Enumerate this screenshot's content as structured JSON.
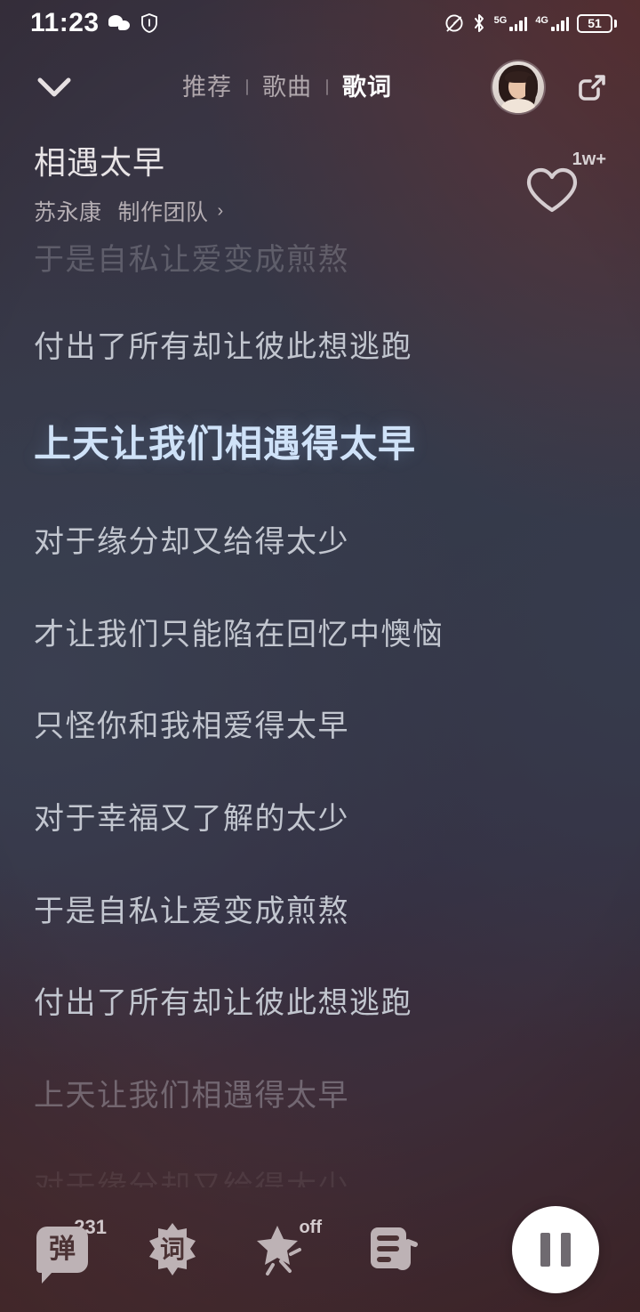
{
  "status_bar": {
    "time": "11:23",
    "icons": [
      "wechat-icon",
      "shield-icon",
      "dnd-icon",
      "bluetooth-icon"
    ],
    "network_5g": "5G",
    "network_5g_sub": "4G",
    "network_4g": "4G",
    "battery_percent": "51"
  },
  "nav": {
    "collapse_icon": "chevron-down-icon",
    "tabs": [
      {
        "label": "推荐",
        "active": false
      },
      {
        "label": "歌曲",
        "active": false
      },
      {
        "label": "歌词",
        "active": true
      }
    ],
    "avatar_label": "avatar",
    "share_icon": "share-icon"
  },
  "song": {
    "title": "相遇太早",
    "artist": "苏永康",
    "credits": "制作团队",
    "credits_chevron": "›",
    "like_count": "1w+",
    "like_icon": "heart-icon"
  },
  "lyrics": {
    "lines": [
      {
        "text": "于是自私让爱变成煎熬",
        "state": "dim-top"
      },
      {
        "text": "付出了所有却让彼此想逃跑",
        "state": "normal"
      },
      {
        "text": "上天让我们相遇得太早",
        "state": "active"
      },
      {
        "text": "对于缘分却又给得太少",
        "state": "normal"
      },
      {
        "text": "才让我们只能陷在回忆中懊恼",
        "state": "normal"
      },
      {
        "text": "只怪你和我相爱得太早",
        "state": "normal"
      },
      {
        "text": "对于幸福又了解的太少",
        "state": "normal"
      },
      {
        "text": "于是自私让爱变成煎熬",
        "state": "normal"
      },
      {
        "text": "付出了所有却让彼此想逃跑",
        "state": "normal"
      },
      {
        "text": "上天让我们相遇得太早",
        "state": "dim-bottom"
      },
      {
        "text": "对于缘分却又给得太少",
        "state": "ghost"
      }
    ]
  },
  "bottom_bar": {
    "danmaku_label": "弹",
    "danmaku_count": "231",
    "lyrics_label": "词",
    "effect_label": "off",
    "effect_icon": "magic-star-icon",
    "playlist_icon": "playlist-icon",
    "play_state_icon": "pause-icon"
  },
  "colors": {
    "accent_active_lyric": "#cfe2f8",
    "lyric_default": "#c2c6cf",
    "bg_warm": "#4d2e31",
    "bg_cool": "#343a4a",
    "play_button": "#ffffff"
  }
}
